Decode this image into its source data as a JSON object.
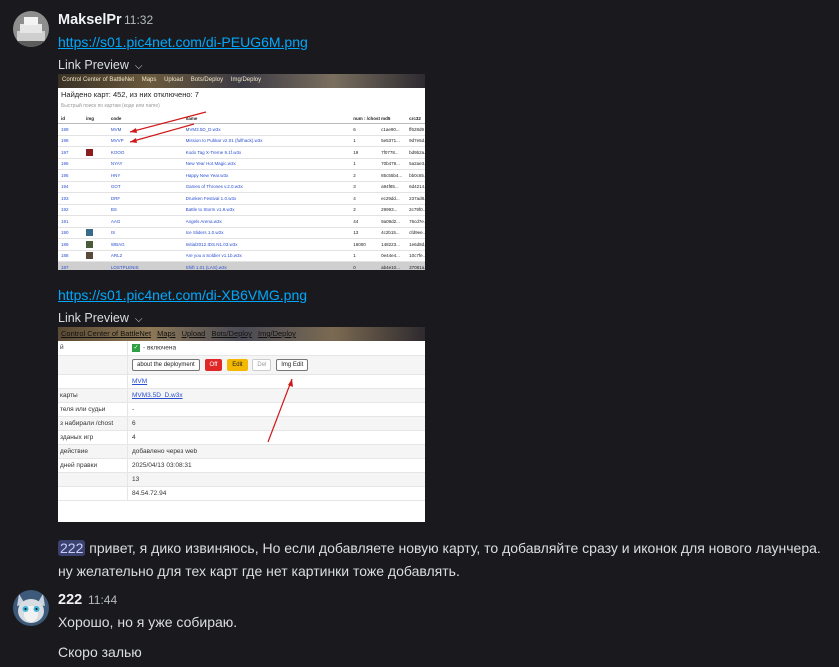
{
  "messages": [
    {
      "author": "MakselPr",
      "time": "11:32",
      "links": [
        "https://s01.pic4net.com/di-PEUG6M.png",
        "https://s01.pic4net.com/di-XB6VMG.png"
      ],
      "preview_label": "Link Preview",
      "text_mention": "222",
      "text_line1": " привет, я дико извиняюсь, Но если добавляете новую карту, то добавляйте сразу и иконок для нового лаунчера.",
      "text_line2": "ну желательно для тех карт где нет картинки тоже добавлять."
    },
    {
      "author": "222",
      "time": "11:44",
      "text_line1": "Хорошо, но я уже собираю.",
      "text_line2": "Скоро залью"
    }
  ],
  "shot1": {
    "menu": [
      "Control Center of BattleNet",
      "Maps",
      "Upload",
      "Bots/Deploy",
      "Img/Deploy"
    ],
    "found": "Найдено карт: 452, из них отключено: 7",
    "search": "Быстрый поиск по картам (коде или name)",
    "headers": [
      "id",
      "img",
      "code",
      "name",
      "num : /chost",
      "md5",
      "crc32"
    ],
    "rows": [
      [
        "199",
        "",
        "MVM",
        "MVM3.5D_D.w3x",
        "6",
        "c1ae90...",
        "ff628d9"
      ],
      [
        "198",
        "",
        "MVVP",
        "Mission to Pubkar v2.01 (fullhack).w3x",
        "1",
        "5e5371...",
        "9d7e5d..."
      ],
      [
        "197",
        "",
        "KOOO",
        "Kodo Tag X-Treme 9.1f.w3x",
        "19",
        "7f0778...",
        "bd9b2a..."
      ],
      [
        "196",
        "",
        "NYAY",
        "New Year Hot Magic.w3x",
        "1",
        "70b479...",
        "5a2ae3..."
      ],
      [
        "195",
        "",
        "HNY",
        "Happy New Year.w3x",
        "2",
        "85c55b4...",
        "bb0c65..."
      ],
      [
        "194",
        "",
        "GOT",
        "Games of Thrones v.2.0.w3x",
        "3",
        "a94f85...",
        "6d4214..."
      ],
      [
        "193",
        "",
        "DRF",
        "Drunken Festival 1.0.w3x",
        "4",
        "ec29dd...",
        "237ad8..."
      ],
      [
        "192",
        "",
        "BS",
        "Battle to Storm v1.8.w3x",
        "2",
        "29993...",
        "2c79f0..."
      ],
      [
        "191",
        "",
        "AAG",
        "Angels Arena.w3x",
        "44",
        "9a09d2...",
        "76cd7e..."
      ],
      [
        "190",
        "",
        "IS",
        "Ice Sliders 1.0.w3x",
        "13",
        "4c2b15...",
        "cfd9ee..."
      ],
      [
        "189",
        "",
        "WBAG",
        "Initial2012.IDS.N1.03.w3x",
        "16000",
        "148223...",
        "1e6d8d..."
      ],
      [
        "188",
        "",
        "ARL2",
        "Are you a Soldier v1.1b.w3x",
        "1",
        "0e44e4...",
        "10c7fe..."
      ],
      [
        "187",
        "",
        "LOSTPLENIS",
        "Shift 1.01 (LAS).w3x",
        "0",
        "ab4e10...",
        "37081a..."
      ]
    ]
  },
  "shot2": {
    "menu": [
      "Control Center of BattleNet",
      "Maps",
      "Upload",
      "Bots/Deploy",
      "Img/Deploy"
    ],
    "status_text": "- включена",
    "buttons": [
      "about the deployment",
      "Off",
      "Edit",
      "Del",
      "Img Edit"
    ],
    "rows": [
      {
        "k": "",
        "v": "MVM"
      },
      {
        "k": "карты",
        "v": "MVM3.5D_D.w3x"
      },
      {
        "k": "теля или судьи",
        "v": "-"
      },
      {
        "k": "з набирали /chost",
        "v": "6"
      },
      {
        "k": "зданых игр",
        "v": "4"
      },
      {
        "k": "действие",
        "v": "добавлено через web"
      },
      {
        "k": "дней правки",
        "v": "2025/04/13 03:08:31"
      },
      {
        "k": "",
        "v": "13"
      },
      {
        "k": "",
        "v": "84.54.72.94"
      }
    ]
  }
}
